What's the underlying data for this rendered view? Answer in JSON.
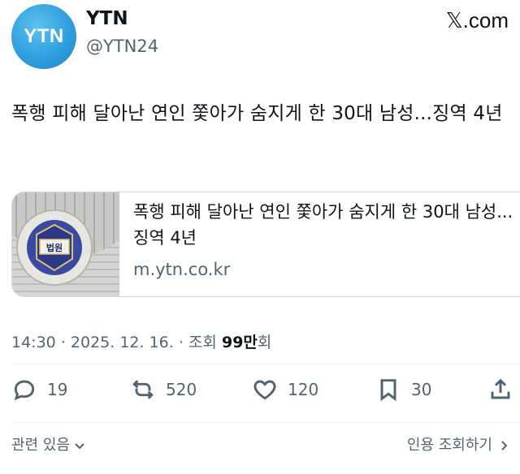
{
  "header": {
    "avatar_text": "YTN",
    "display_name": "YTN",
    "handle": "@YTN24",
    "site": ".com"
  },
  "tweet": {
    "text": "폭행 피해 달아난 연인 쫓아가 숨지게 한 30대 남성...징역 4년"
  },
  "card": {
    "title": "폭행 피해 달아난 연인 쫓아가 숨지게 한 30대 남성...징역 4년",
    "domain": "m.ytn.co.kr",
    "emblem_text": "법원"
  },
  "meta": {
    "time": "14:30",
    "date": "2025. 12. 16.",
    "views_label": "조회",
    "views_value": "99만",
    "views_suffix": "회"
  },
  "actions": {
    "replies": "19",
    "reposts": "520",
    "likes": "120",
    "bookmarks": "30"
  },
  "footer": {
    "related_label": "관련 있음",
    "quotes_label": "인용 조회하기"
  },
  "icons": [
    "chat-bubble-icon",
    "repost-icon",
    "heart-icon",
    "bookmark-icon",
    "share-icon",
    "chevron-down-icon",
    "chevron-right-icon",
    "x-logo-icon"
  ]
}
